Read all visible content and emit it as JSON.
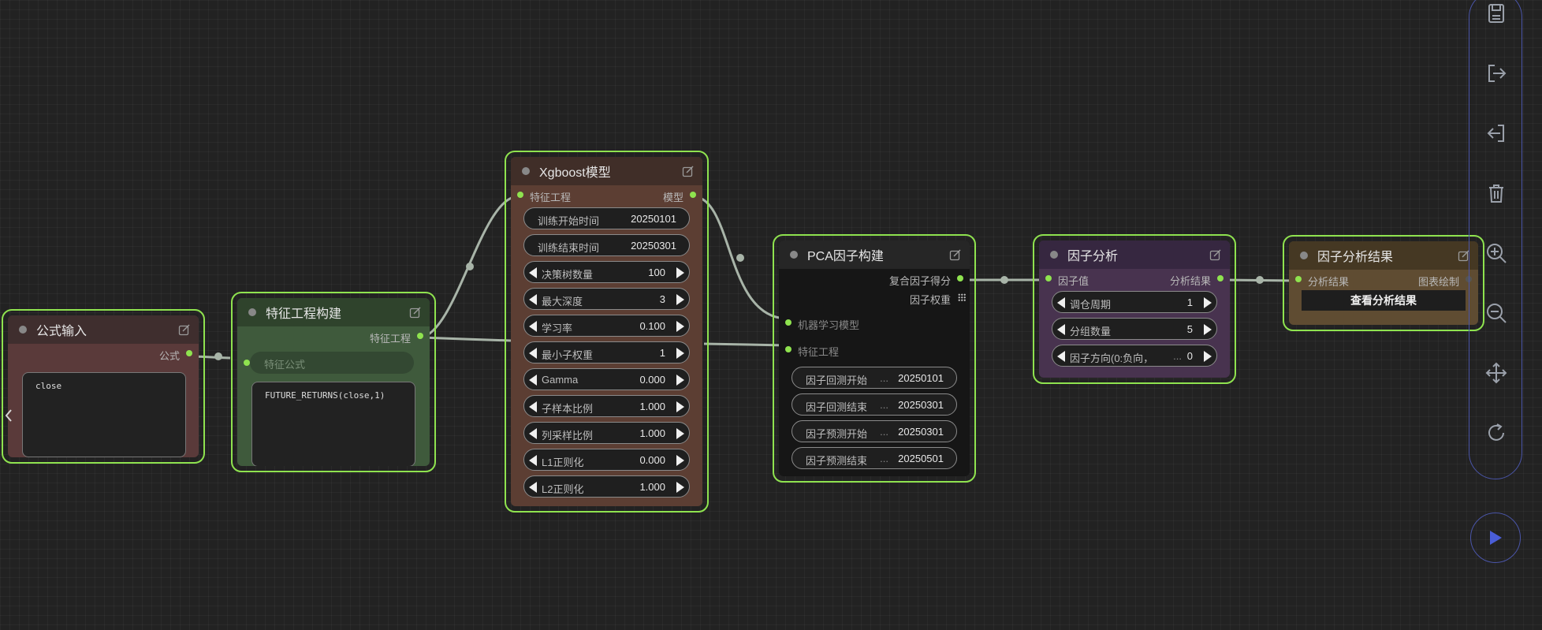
{
  "nodes": {
    "formula_input": {
      "title": "公式输入",
      "output_label": "公式",
      "text": "close"
    },
    "feature_engineering": {
      "title": "特征工程构建",
      "output_label": "特征工程",
      "input_placeholder": "特征公式",
      "text": "FUTURE_RETURNS(close,1)"
    },
    "xgboost": {
      "title": "Xgboost模型",
      "input_label": "特征工程",
      "output_label": "模型",
      "fields": [
        {
          "label": "训练开始时间",
          "value": "20250101"
        },
        {
          "label": "训练结束时间",
          "value": "20250301"
        }
      ],
      "params": [
        {
          "label": "决策树数量",
          "value": "100"
        },
        {
          "label": "最大深度",
          "value": "3"
        },
        {
          "label": "学习率",
          "value": "0.100"
        },
        {
          "label": "最小子权重",
          "value": "1"
        },
        {
          "label": "Gamma",
          "value": "0.000"
        },
        {
          "label": "子样本比例",
          "value": "1.000"
        },
        {
          "label": "列采样比例",
          "value": "1.000"
        },
        {
          "label": "L1正则化",
          "value": "0.000"
        },
        {
          "label": "L2正则化",
          "value": "1.000"
        }
      ]
    },
    "pca": {
      "title": "PCA因子构建",
      "outputs": [
        "复合因子得分",
        "因子权重"
      ],
      "inputs": [
        "机器学习模型",
        "特征工程"
      ],
      "ellipsis": "...",
      "fields": [
        {
          "label": "因子回测开始",
          "value": "20250101"
        },
        {
          "label": "因子回测结束",
          "value": "20250301"
        },
        {
          "label": "因子预测开始",
          "value": "20250301"
        },
        {
          "label": "因子预测结束",
          "value": "20250501"
        }
      ]
    },
    "factor_analysis": {
      "title": "因子分析",
      "input_label": "因子值",
      "output_label": "分析结果",
      "ellipsis": "...",
      "params": [
        {
          "label": "调仓周期",
          "value": "1"
        },
        {
          "label": "分组数量",
          "value": "5"
        },
        {
          "label": "因子方向(0:负向，",
          "value": "0"
        }
      ]
    },
    "factor_result": {
      "title": "因子分析结果",
      "input_label": "分析结果",
      "output_label": "图表绘制",
      "button_label": "查看分析结果"
    }
  },
  "colors": {
    "canvas": "#222222",
    "selection_outline": "#8fe34f",
    "slot_dot": "#8fe34f",
    "formula_node": "#5a3a3a",
    "feature_node": "#3f5a3c",
    "xgboost_node": "#5c3e33",
    "pca_node": "#161616",
    "analysis_node": "#48334f",
    "result_node": "#5f4c32",
    "toolbar_border": "#4a55a8",
    "run_icon": "#4a5ed8"
  },
  "icons": {
    "node_edit": "edit-icon",
    "sidebar_collapse": "chevron-left-icon",
    "toolbar": [
      "save-icon",
      "export-icon",
      "import-icon",
      "trash-icon",
      "zoom-in-icon",
      "zoom-out-icon",
      "move-icon",
      "refresh-icon"
    ],
    "run": "play-icon"
  }
}
